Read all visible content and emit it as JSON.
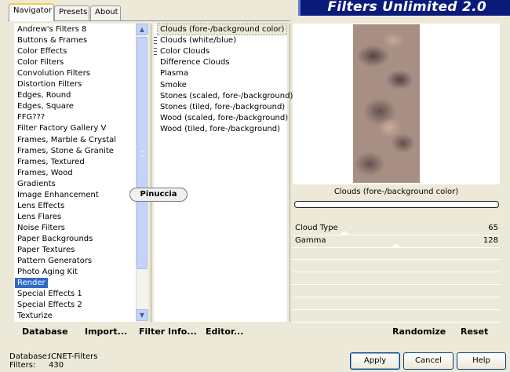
{
  "tabs": [
    "Navigator",
    "Presets",
    "About"
  ],
  "banner": {
    "title": "Filters Unlimited 2.0"
  },
  "categories": [
    "Andrew's Filters 8",
    "Buttons & Frames",
    "Color Effects",
    "Color Filters",
    "Convolution Filters",
    "Distortion Filters",
    "Edges, Round",
    "Edges, Square",
    "FFG???",
    "Filter Factory Gallery V",
    "Frames, Marble & Crystal",
    "Frames, Stone & Granite",
    "Frames, Textured",
    "Frames, Wood",
    "Gradients",
    "Image Enhancement",
    "Lens Effects",
    "Lens Flares",
    "Noise Filters",
    "Paper Backgrounds",
    "Paper Textures",
    "Pattern Generators",
    "Photo Aging Kit",
    "Render",
    "Special Effects 1",
    "Special Effects 2",
    "Texturize"
  ],
  "selected_category": "Render",
  "filters": [
    "Clouds (fore-/background color)",
    "Clouds (white/blue)",
    "Color Clouds",
    "Difference Clouds",
    "Plasma",
    "Smoke",
    "Stones (scaled, fore-/background)",
    "Stones (tiled, fore-/background)",
    "Wood (scaled, fore-/background)",
    "Wood (tiled, fore-/background)"
  ],
  "selected_filter": "Clouds (fore-/background color)",
  "watermark": "Pinuccia",
  "preview": {
    "caption": "Clouds (fore-/background color)",
    "progress": 0
  },
  "sliders": [
    {
      "label": "Cloud Type",
      "value": "65"
    },
    {
      "label": "Gamma",
      "value": "128"
    }
  ],
  "toolbar": {
    "database": "Database",
    "import": "Import...",
    "filter_info": "Filter Info...",
    "editor": "Editor...",
    "randomize": "Randomize",
    "reset": "Reset"
  },
  "status": {
    "database_label": "Database:",
    "database_value": "ICNET-Filters",
    "filters_label": "Filters:",
    "filters_value": "430"
  },
  "buttons": {
    "apply": "Apply",
    "cancel": "Cancel",
    "help": "Help"
  }
}
